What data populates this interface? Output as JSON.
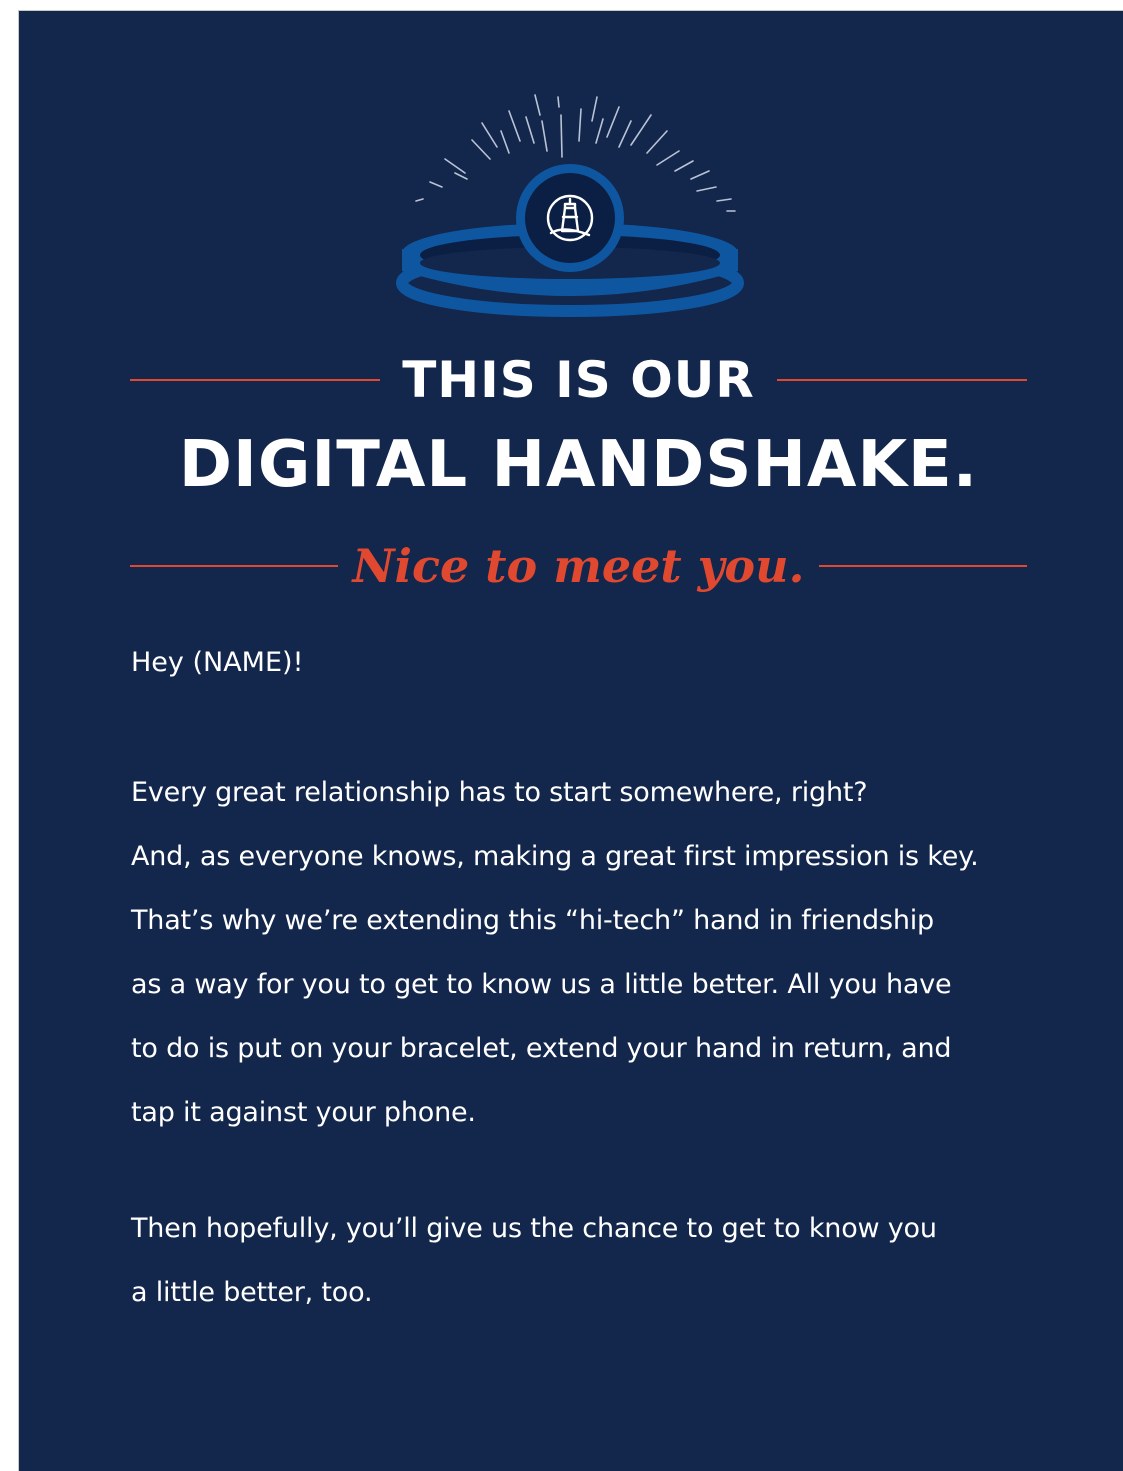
{
  "headline": {
    "small": "THIS IS OUR",
    "big": "DIGITAL HANDSHAKE.",
    "script": "Nice to meet you."
  },
  "body": {
    "greeting": "Hey (NAME)!",
    "paragraph1": [
      "Every great relationship has to start somewhere, right?",
      "And, as everyone knows, making a great first impression is key.",
      "That’s why we’re extending this  “hi-tech” hand in friendship",
      "as a way for you to get to know us a little better. All you have",
      "to do is put on your bracelet, extend your hand in return, and",
      "tap it against your phone."
    ],
    "paragraph2": [
      "Then hopefully, you’ll give us the chance to get to know you",
      "a little better, too."
    ]
  },
  "colors": {
    "background": "#13264c",
    "accent": "#e0492f",
    "text": "#ffffff",
    "bracelet_light": "#0e57a0",
    "bracelet_dark": "#0b1f44"
  },
  "icons": {
    "bracelet": "bracelet-icon",
    "lighthouse": "lighthouse-icon",
    "rays": "sunburst-rays"
  }
}
